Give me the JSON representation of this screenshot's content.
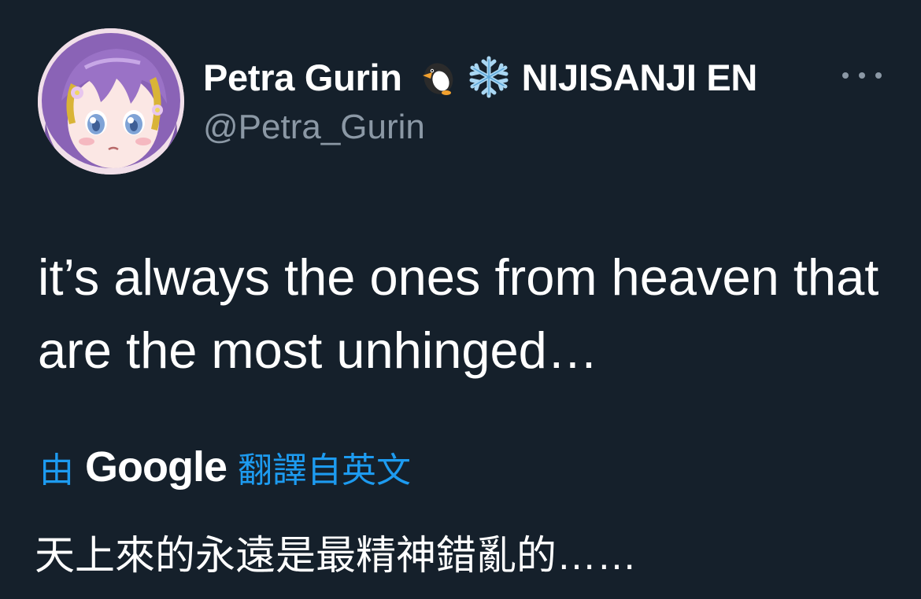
{
  "author": {
    "display_name": "Petra Gurin",
    "name_icons": [
      "penguin-icon",
      "snowflake-icon"
    ],
    "name_suffix": "NIJISANJI EN",
    "handle": "@Petra_Gurin",
    "avatar": "anime-avatar-image"
  },
  "tweet": {
    "text": "it’s always the ones from heaven that are the most unhinged…"
  },
  "translation": {
    "by_label": "由",
    "provider": "Google",
    "from_label": "翻譯自英文",
    "text": "天上來的永遠是最精神錯亂的……"
  },
  "colors": {
    "background": "#15202b",
    "primary_text": "#ffffff",
    "secondary_text": "#8b98a5",
    "link": "#1d9bf0"
  },
  "icons": {
    "more": "more-options-icon"
  }
}
